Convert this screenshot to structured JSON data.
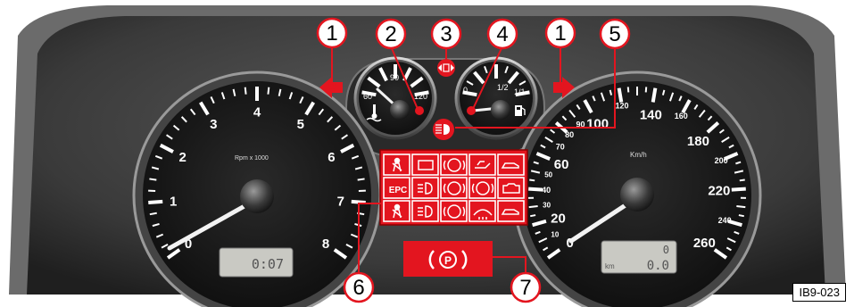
{
  "figure_ref": "IB9-023",
  "tachometer": {
    "unit_label": "Rpm x 1000",
    "ticks": [
      "0",
      "1",
      "2",
      "3",
      "4",
      "5",
      "6",
      "7",
      "8"
    ],
    "lcd_value": "0:07"
  },
  "speedometer": {
    "unit_label": "Km/h",
    "ticks": [
      "0",
      "10",
      "20",
      "30",
      "40",
      "50",
      "60",
      "70",
      "80",
      "90",
      "100",
      "120",
      "140",
      "160",
      "180",
      "200",
      "220",
      "240",
      "260"
    ],
    "lcd_top": "0",
    "lcd_unit": "km",
    "lcd_value": "0.0"
  },
  "temp_gauge": {
    "ticks": [
      "60",
      "90",
      "120"
    ]
  },
  "fuel_gauge": {
    "ticks": [
      "0",
      "1/2",
      "1/1"
    ]
  },
  "warning_panel": {
    "epc_label": "EPC"
  },
  "brake_light": {
    "label": "(P)"
  },
  "callouts": [
    "1",
    "2",
    "3",
    "4",
    "1",
    "5",
    "6",
    "7"
  ],
  "colors": {
    "warning_red": "#e3151f",
    "dash_dark": "#2b2b2b",
    "gauge_face": "#1a1a1a",
    "callout_line": "#e3151f"
  }
}
